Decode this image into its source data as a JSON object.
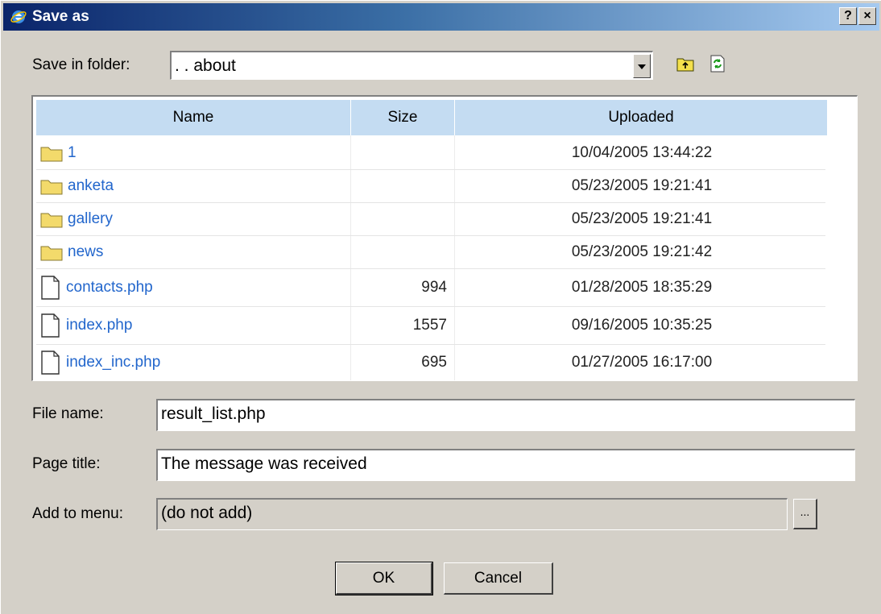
{
  "window": {
    "title": "Save as",
    "help_label": "?",
    "close_label": "×"
  },
  "save_in": {
    "label": "Save in folder:",
    "value": ". . about"
  },
  "toolbar": {
    "up_icon": "folder-up-icon",
    "refresh_icon": "refresh-icon"
  },
  "file_list": {
    "columns": [
      "Name",
      "Size",
      "Uploaded"
    ],
    "rows": [
      {
        "type": "folder",
        "name": "1",
        "size": "",
        "uploaded": "10/04/2005 13:44:22"
      },
      {
        "type": "folder",
        "name": "anketa",
        "size": "",
        "uploaded": "05/23/2005 19:21:41"
      },
      {
        "type": "folder",
        "name": "gallery",
        "size": "",
        "uploaded": "05/23/2005 19:21:41"
      },
      {
        "type": "folder",
        "name": "news",
        "size": "",
        "uploaded": "05/23/2005 19:21:42"
      },
      {
        "type": "file",
        "name": "contacts.php",
        "size": "994",
        "uploaded": "01/28/2005 18:35:29"
      },
      {
        "type": "file",
        "name": "index.php",
        "size": "1557",
        "uploaded": "09/16/2005 10:35:25"
      },
      {
        "type": "file",
        "name": "index_inc.php",
        "size": "695",
        "uploaded": "01/27/2005 16:17:00"
      }
    ]
  },
  "form": {
    "file_name_label": "File name:",
    "file_name_value": "result_list.php",
    "page_title_label": "Page title:",
    "page_title_value": "The message was received",
    "menu_label": "Add to menu:",
    "menu_value": "(do not add)",
    "browse_label": "..."
  },
  "buttons": {
    "ok": "OK",
    "cancel": "Cancel"
  }
}
